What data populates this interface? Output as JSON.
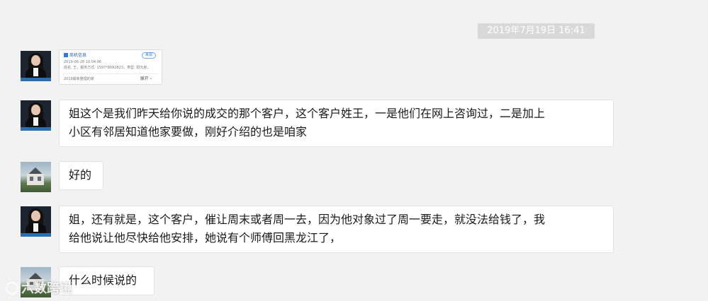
{
  "chat": {
    "timestamp": "2019年7月19日 16:41",
    "messages": [
      {
        "sender": "agent",
        "type": "card",
        "card": {
          "title": "商机信息",
          "badge": "来源",
          "line1": "2019-06-28 10:04:06",
          "line2": "姓名: 王，服务方式: 1597*8092823，类型: 阳光房，",
          "line3": "2019最新整理的家",
          "more": "展开 ›"
        }
      },
      {
        "sender": "agent",
        "type": "text",
        "line1": "姐这个是我们昨天给你说的成交的那个客户，这个客户姓王，一是他们在网上咨询过，二是加上",
        "line2": "小区有邻居知道他家要做，刚好介绍的也是咱家"
      },
      {
        "sender": "customer",
        "type": "text",
        "line1": "好的"
      },
      {
        "sender": "agent",
        "type": "text",
        "line1": "姐，还有就是，这个客户，催让周末或者周一去，因为他对象过了周一要走，就没法给钱了，我",
        "line2": "给他说让他尽快给他安排，她说有个师傅回黑龙江了，"
      },
      {
        "sender": "customer",
        "type": "text",
        "line1": "什么时候说的"
      }
    ]
  },
  "watermark": "六数跨境",
  "icons": {
    "agent_avatar": "woman-portrait-avatar",
    "customer_avatar": "house-avatar"
  }
}
